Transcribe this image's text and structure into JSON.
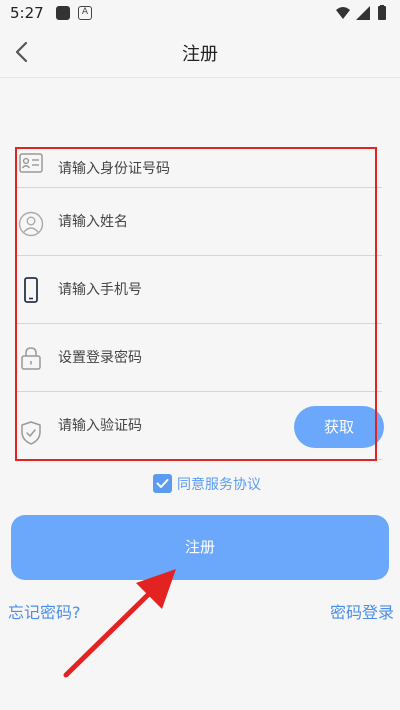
{
  "status_bar": {
    "time": "5:27",
    "notification_letter": "A"
  },
  "header": {
    "title": "注册"
  },
  "form": {
    "id_number_placeholder": "请输入身份证号码",
    "name_placeholder": "请输入姓名",
    "phone_placeholder": "请输入手机号",
    "password_placeholder": "设置登录密码",
    "code_placeholder": "请输入验证码",
    "get_code_label": "获取"
  },
  "agreement": {
    "checked": true,
    "label": "同意服务协议"
  },
  "actions": {
    "register_label": "注册",
    "forgot_password": "忘记密码?",
    "password_login": "密码登录"
  },
  "colors": {
    "accent": "#6ba8fb",
    "link": "#4b8ee8",
    "annotation": "#e32222"
  },
  "annotations": {
    "highlight_box": "red-rectangle",
    "pointer": "red-arrow"
  }
}
